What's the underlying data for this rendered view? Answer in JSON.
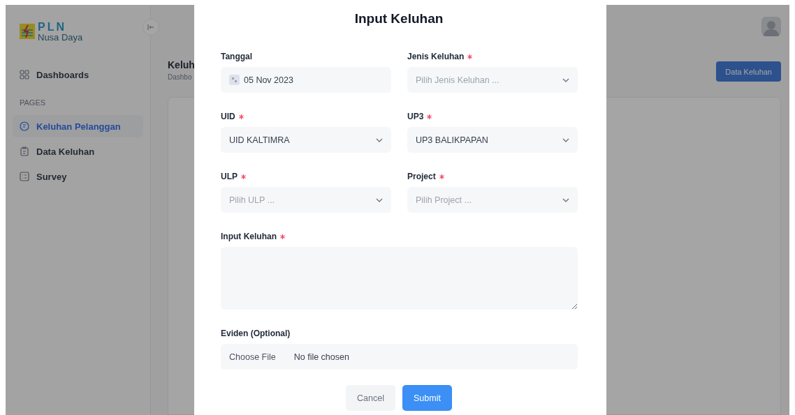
{
  "sidebar": {
    "logo": {
      "title": "PLN",
      "subtitle": "Nusa Daya"
    },
    "top_items": [
      {
        "label": "Dashboards",
        "selected": false
      }
    ],
    "section_label": "PAGES",
    "items": [
      {
        "label": "Keluhan Pelanggan",
        "selected": true
      },
      {
        "label": "Data Keluhan",
        "selected": false
      },
      {
        "label": "Survey",
        "selected": false
      }
    ]
  },
  "page": {
    "title": "Keluh",
    "breadcrumb": "Dashbo",
    "action_button": "Data Keluhan"
  },
  "modal": {
    "title": "Input Keluhan",
    "fields": [
      {
        "kind": "date",
        "label": "Tanggal",
        "required": false,
        "value": "05 Nov 2023"
      },
      {
        "kind": "select",
        "label": "Jenis Keluhan",
        "required": true,
        "placeholder": "Pilih Jenis Keluhan ..."
      },
      {
        "kind": "select",
        "label": "UID",
        "required": true,
        "value": "UID KALTIMRA"
      },
      {
        "kind": "select",
        "label": "UP3",
        "required": true,
        "value": "UP3 BALIKPAPAN"
      },
      {
        "kind": "select",
        "label": "ULP",
        "required": true,
        "placeholder": "Pilih ULP ..."
      },
      {
        "kind": "select",
        "label": "Project",
        "required": true,
        "placeholder": "Pilih Project ..."
      },
      {
        "kind": "textarea",
        "label": "Input Keluhan",
        "required": true
      },
      {
        "kind": "file",
        "label": "Eviden (Optional)",
        "required": false,
        "button": "Choose File",
        "value": "No file chosen"
      }
    ],
    "buttons": [
      {
        "label": "Cancel",
        "kind": "secondary"
      },
      {
        "label": "Submit",
        "kind": "primary"
      }
    ]
  }
}
